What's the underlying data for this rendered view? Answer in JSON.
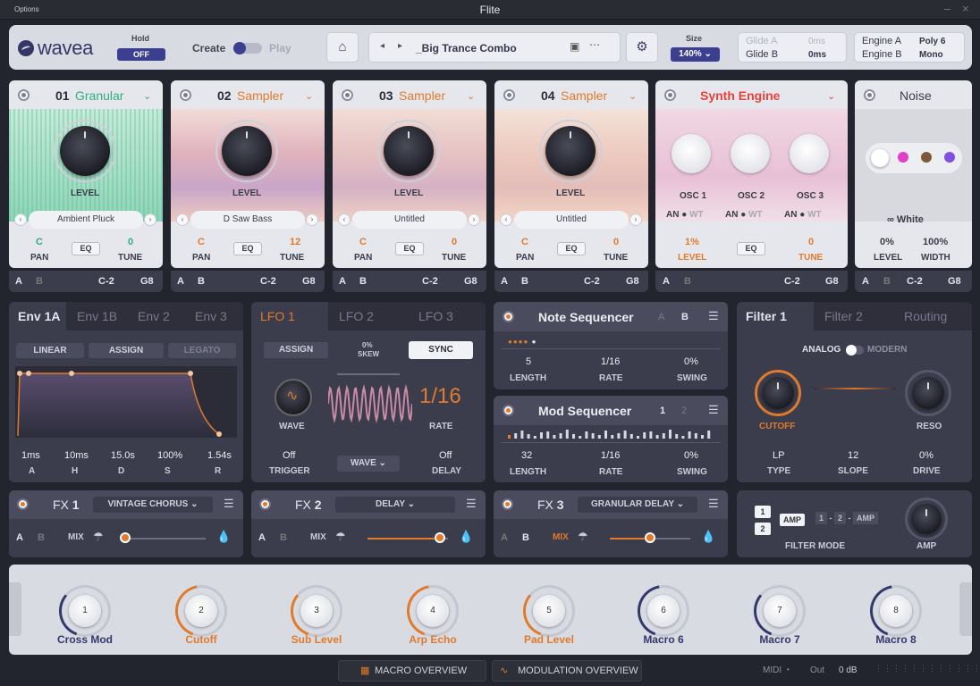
{
  "window": {
    "title": "Flite",
    "options": "Options"
  },
  "topbar": {
    "logo": "wavea",
    "hold_label": "Hold",
    "hold_value": "OFF",
    "create_label": "Create",
    "play_label": "Play",
    "preset_name": "_Big Trance Combo",
    "size_label": "Size",
    "size_value": "140%",
    "glide_a": "Glide A",
    "glide_a_val": "0ms",
    "glide_b": "Glide B",
    "glide_b_val": "0ms",
    "engine_a": "Engine A",
    "engine_a_val": "Poly 6",
    "engine_b": "Engine B",
    "engine_b_val": "Mono"
  },
  "engines": [
    {
      "num": "01",
      "type": "Granular",
      "color": "#2fae7b",
      "preset": "Ambient Pluck",
      "level_label": "LEVEL",
      "pan": "C",
      "pan_label": "PAN",
      "eq": "EQ",
      "tune": "0",
      "tune_label": "TUNE",
      "a": "A",
      "b": "B",
      "low": "C-2",
      "high": "G8"
    },
    {
      "num": "02",
      "type": "Sampler",
      "color": "#e07a2c",
      "preset": "D Saw Bass",
      "level_label": "LEVEL",
      "pan": "C",
      "pan_label": "PAN",
      "eq": "EQ",
      "tune": "12",
      "tune_label": "TUNE",
      "a": "A",
      "b": "B",
      "low": "C-2",
      "high": "G8"
    },
    {
      "num": "03",
      "type": "Sampler",
      "color": "#e07a2c",
      "preset": "Untitled",
      "level_label": "LEVEL",
      "pan": "C",
      "pan_label": "PAN",
      "eq": "EQ",
      "tune": "0",
      "tune_label": "TUNE",
      "a": "A",
      "b": "B",
      "low": "C-2",
      "high": "G8"
    },
    {
      "num": "04",
      "type": "Sampler",
      "color": "#e07a2c",
      "preset": "Untitled",
      "level_label": "LEVEL",
      "pan": "C",
      "pan_label": "PAN",
      "eq": "EQ",
      "tune": "0",
      "tune_label": "TUNE",
      "a": "A",
      "b": "B",
      "low": "C-2",
      "high": "G8"
    }
  ],
  "synth": {
    "title": "Synth Engine",
    "osc1": "OSC 1",
    "osc2": "OSC 2",
    "osc3": "OSC 3",
    "an": "AN",
    "wt": "WT",
    "level": "1%",
    "level_label": "LEVEL",
    "eq": "EQ",
    "tune": "0",
    "tune_label": "TUNE",
    "a": "A",
    "b": "B",
    "low": "C-2",
    "high": "G8"
  },
  "noise": {
    "title": "Noise",
    "type": "White",
    "level": "0%",
    "level_label": "LEVEL",
    "width": "100%",
    "width_label": "WIDTH",
    "a": "A",
    "b": "B",
    "low": "C-2",
    "high": "G8"
  },
  "env": {
    "tabs": [
      "Env 1A",
      "Env 1B",
      "Env 2",
      "Env 3"
    ],
    "modes": [
      "LINEAR",
      "ASSIGN",
      "LEGATO"
    ],
    "params": [
      {
        "v": "1ms",
        "l": "A"
      },
      {
        "v": "10ms",
        "l": "H"
      },
      {
        "v": "15.0s",
        "l": "D"
      },
      {
        "v": "100%",
        "l": "S"
      },
      {
        "v": "1.54s",
        "l": "R"
      }
    ]
  },
  "lfo": {
    "tabs": [
      "LFO 1",
      "LFO 2",
      "LFO 3"
    ],
    "assign": "ASSIGN",
    "skew_val": "0%",
    "skew_label": "SKEW",
    "sync": "SYNC",
    "wave_label": "WAVE",
    "rate": "1/16",
    "rate_label": "RATE",
    "trigger": "Off",
    "trigger_label": "TRIGGER",
    "wave_dd": "WAVE",
    "delay": "Off",
    "delay_label": "DELAY"
  },
  "note_seq": {
    "title": "Note Sequencer",
    "a": "A",
    "b": "B",
    "length": "5",
    "length_label": "LENGTH",
    "rate": "1/16",
    "rate_label": "RATE",
    "swing": "0%",
    "swing_label": "SWING"
  },
  "mod_seq": {
    "title": "Mod Sequencer",
    "p1": "1",
    "p2": "2",
    "length": "32",
    "length_label": "LENGTH",
    "rate": "1/16",
    "rate_label": "RATE",
    "swing": "0%",
    "swing_label": "SWING"
  },
  "filter": {
    "tabs": [
      "Filter 1",
      "Filter 2",
      "Routing"
    ],
    "analog": "ANALOG",
    "modern": "MODERN",
    "cutoff_label": "CUTOFF",
    "reso_label": "RESO",
    "type": "LP",
    "type_label": "TYPE",
    "slope": "12",
    "slope_label": "SLOPE",
    "drive": "0%",
    "drive_label": "DRIVE"
  },
  "fx": [
    {
      "label": "FX",
      "num": "1",
      "effect": "VINTAGE CHORUS",
      "mix": "MIX",
      "a": "A",
      "b": "B",
      "mix_value": 0.0
    },
    {
      "label": "FX",
      "num": "2",
      "effect": "DELAY",
      "mix": "MIX",
      "a": "A",
      "b": "B",
      "mix_value": 0.9
    },
    {
      "label": "FX",
      "num": "3",
      "effect": "GRANULAR DELAY",
      "mix": "MIX",
      "a": "A",
      "b": "B",
      "mix_value": 0.5
    }
  ],
  "filter_mode": {
    "n1": "1",
    "n2": "2",
    "amp": "AMP",
    "chain1": "1",
    "chain2": "2",
    "chain_amp": "AMP",
    "label": "FILTER MODE",
    "amp_label": "AMP"
  },
  "macros": [
    {
      "n": "1",
      "name": "Cross Mod",
      "color": "#34376a"
    },
    {
      "n": "2",
      "name": "Cutoff",
      "color": "#e07a2c"
    },
    {
      "n": "3",
      "name": "Sub Level",
      "color": "#e07a2c"
    },
    {
      "n": "4",
      "name": "Arp Echo",
      "color": "#e07a2c"
    },
    {
      "n": "5",
      "name": "Pad Level",
      "color": "#e07a2c"
    },
    {
      "n": "6",
      "name": "Macro 6",
      "color": "#34376a"
    },
    {
      "n": "7",
      "name": "Macro 7",
      "color": "#34376a"
    },
    {
      "n": "8",
      "name": "Macro 8",
      "color": "#34376a"
    }
  ],
  "footer": {
    "macro_overview": "MACRO OVERVIEW",
    "mod_overview": "MODULATION OVERVIEW",
    "midi": "MIDI",
    "out": "Out",
    "db": "0 dB"
  }
}
